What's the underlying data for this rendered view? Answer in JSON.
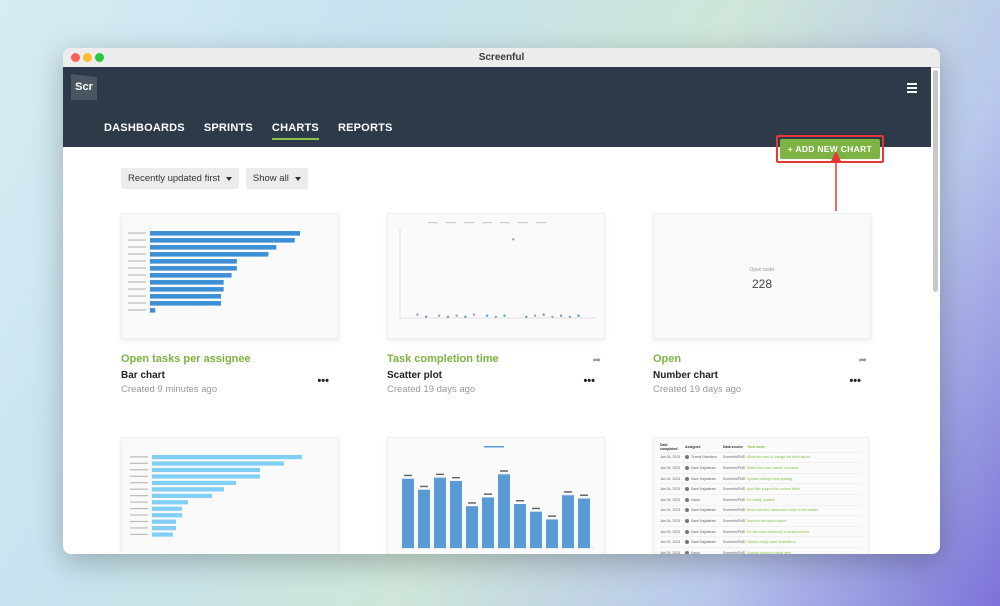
{
  "window": {
    "title": "Screenful"
  },
  "logo": {
    "text": "Scr"
  },
  "nav": {
    "items": [
      "DASHBOARDS",
      "SPRINTS",
      "CHARTS",
      "REPORTS"
    ],
    "active": "CHARTS"
  },
  "add_button": {
    "label": "+ ADD NEW CHART"
  },
  "filters": {
    "sort": "Recently updated first",
    "show": "Show all"
  },
  "cards": [
    {
      "title": "Open tasks per assignee",
      "type": "Bar chart",
      "updated": "Created 9 minutes ago"
    },
    {
      "title": "Task completion time",
      "type": "Scatter plot",
      "updated": "Created 19 days ago"
    },
    {
      "title": "Open",
      "type": "Number chart",
      "updated": "Created 19 days ago",
      "number_label": "Open tasks",
      "number_value": "228"
    }
  ],
  "icons": {
    "share": "share-icon",
    "more": "more-options-icon",
    "menu": "hamburger-menu-icon"
  },
  "colors": {
    "navbar": "#2d3a4a",
    "accent": "#7cb342",
    "highlight": "#e53935",
    "bar_blue": "#3d8fd6",
    "bar_light": "#81cff5",
    "column": "#5b9bd5"
  },
  "chart_data": [
    {
      "type": "bar",
      "orientation": "horizontal",
      "series": [
        {
          "values": [
            57,
            55,
            48,
            45,
            33,
            33,
            31,
            28,
            28,
            27,
            27,
            2
          ]
        }
      ]
    },
    {
      "type": "scatter",
      "series": [
        {
          "x": [
            8,
            12,
            18,
            22,
            26,
            30,
            34,
            40,
            44,
            48,
            52,
            58,
            62,
            66,
            70,
            74,
            78,
            82
          ],
          "y": [
            3,
            1,
            2,
            1,
            2,
            1,
            3,
            2,
            1,
            2,
            70,
            1,
            2,
            3,
            1,
            2,
            1,
            2
          ]
        }
      ]
    },
    {
      "type": "bar",
      "orientation": "horizontal",
      "series": [
        {
          "values": [
            100,
            88,
            72,
            72,
            56,
            48,
            40,
            24,
            20,
            20,
            16,
            16,
            14
          ]
        }
      ]
    },
    {
      "type": "bar",
      "orientation": "vertical",
      "series": [
        {
          "values": [
            63,
            53,
            64,
            61,
            38,
            46,
            67,
            40,
            33,
            26,
            48,
            45
          ]
        }
      ]
    }
  ],
  "table_thumb": {
    "headers": [
      "Date completed",
      "Assignee",
      "Data source",
      "Task name"
    ],
    "rows": [
      [
        "Jan 04, 2023",
        "Tommi Nieminen",
        "ScreenfulFMD",
        "Allow the user to change the table layout"
      ],
      [
        "Jan 04, 2023",
        "Sami Kajalainen",
        "ScreenfulFMD",
        "Refine the color palette on charts"
      ],
      [
        "Jan 04, 2023",
        "Sami Kajalainen",
        "ScreenfulFMD",
        "Update settings view spacing"
      ],
      [
        "Jan 04, 2023",
        "Sami Kajalainen",
        "ScreenfulFMD",
        "Add filter support for custom fields"
      ],
      [
        "Jan 04, 2023",
        "Kayla",
        "ScreenfulFMD",
        "Fix tooltip position"
      ],
      [
        "Jan 04, 2023",
        "Sami Kajalainen",
        "ScreenfulFMD",
        "Show selected dashboard name in the header"
      ],
      [
        "Jan 04, 2023",
        "Sami Kajalainen",
        "ScreenfulFMD",
        "Improve the report export"
      ],
      [
        "Jan 03, 2023",
        "Sami Kajalainen",
        "ScreenfulFMD",
        "Fix the chart rendering on small screens"
      ],
      [
        "Jan 03, 2023",
        "Sami Kajalainen",
        "ScreenfulFMD",
        "Update empty state illustrations"
      ],
      [
        "Jan 03, 2023",
        "Kayla",
        "ScreenfulFMD",
        "Support sorting in table view"
      ],
      [
        "Jan 03, 2023",
        "Sami Kajalainen",
        "ScreenfulFMD",
        "Allow editing the sprint dates"
      ],
      [
        "Jan 02, 2023",
        "Sami Kajalainen",
        "ScreenfulFMD",
        "Add integration settings page"
      ]
    ]
  }
}
